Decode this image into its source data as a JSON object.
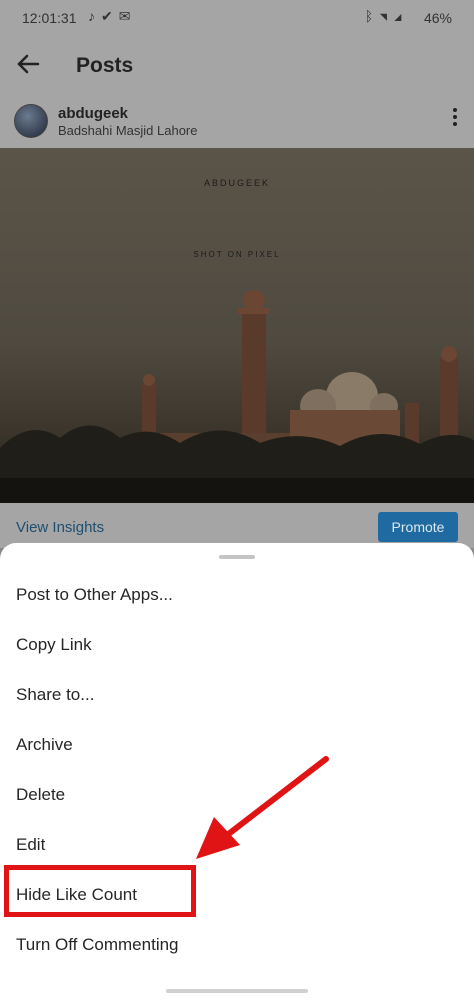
{
  "status_bar": {
    "time": "12:01:31",
    "notification_icons": [
      "music-note-icon",
      "check-icon",
      "mail-icon"
    ],
    "system_icons": [
      "bluetooth-icon",
      "wifi-icon",
      "signal-icon"
    ],
    "battery": "46%"
  },
  "header": {
    "back_icon": "back-arrow-icon",
    "title": "Posts"
  },
  "post": {
    "username": "abdugeek",
    "location": "Badshahi Masjid Lahore",
    "photo_watermark_top": "ABDUGEEK",
    "photo_watermark_sub": "SHOT ON PIXEL",
    "view_insights": "View Insights",
    "promote": "Promote"
  },
  "sheet": {
    "items": [
      "Post to Other Apps...",
      "Copy Link",
      "Share to...",
      "Archive",
      "Delete",
      "Edit",
      "Hide Like Count",
      "Turn Off Commenting"
    ],
    "highlighted_item": "Hide Like Count"
  },
  "colors": {
    "annotation_red": "#e01414",
    "promote_blue": "#1f6aa0"
  }
}
